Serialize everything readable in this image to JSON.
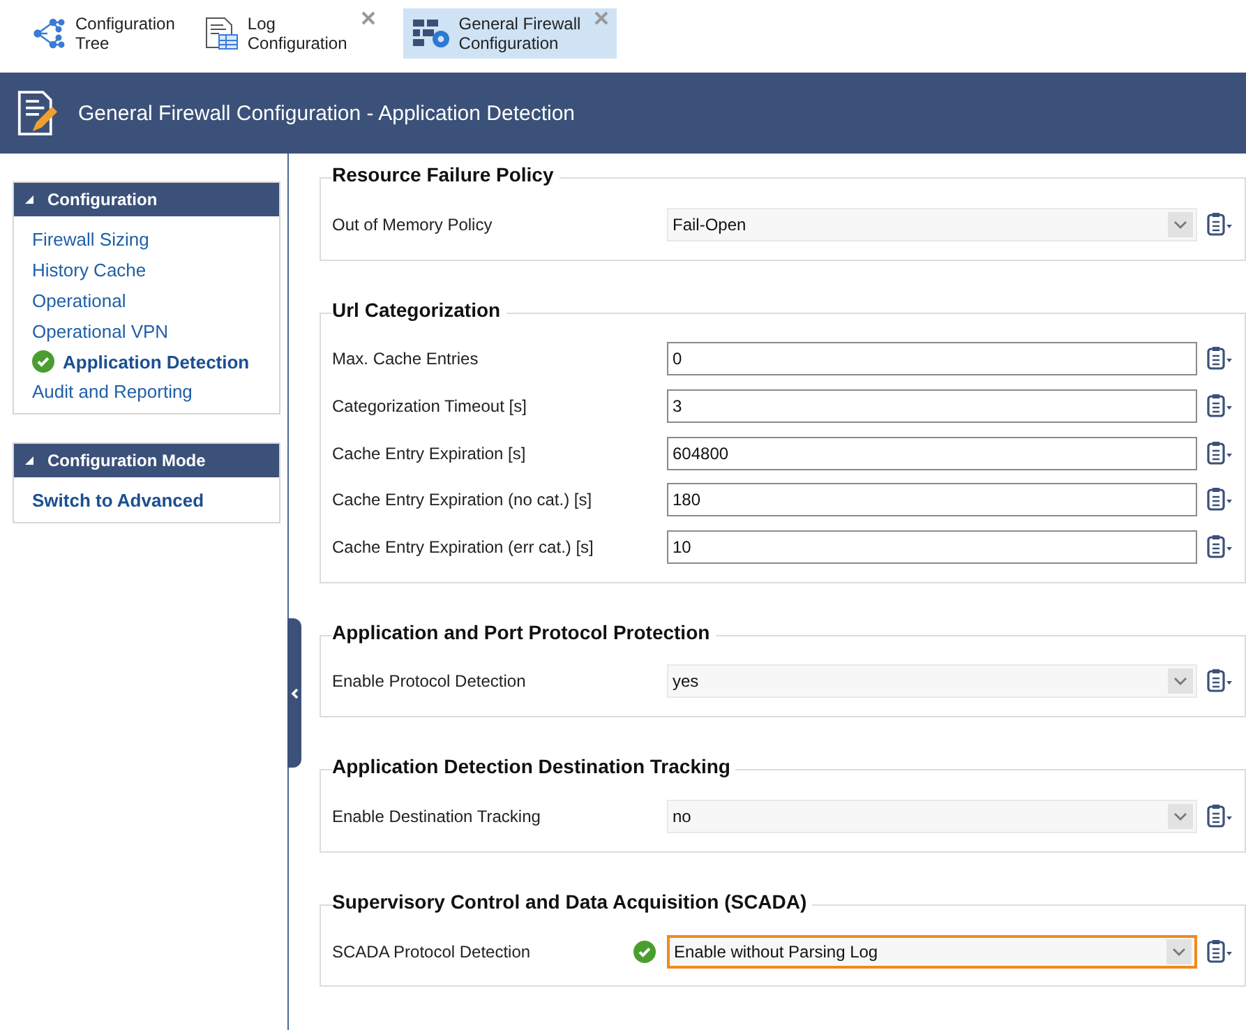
{
  "tabs": [
    {
      "label": "Configuration\nTree",
      "closable": false,
      "selected": false
    },
    {
      "label": "Log\nConfiguration",
      "closable": true,
      "selected": false
    },
    {
      "label": "General Firewall\nConfiguration",
      "closable": true,
      "selected": true
    }
  ],
  "header": {
    "title": "General Firewall Configuration - Application Detection"
  },
  "sidebar": [
    {
      "title": "Configuration",
      "expanded": true,
      "items": [
        {
          "label": "Firewall Sizing",
          "selected": false
        },
        {
          "label": "History Cache",
          "selected": false
        },
        {
          "label": "Operational",
          "selected": false
        },
        {
          "label": "Operational VPN",
          "selected": false
        },
        {
          "label": "Application Detection",
          "selected": true
        },
        {
          "label": "Audit and Reporting",
          "selected": false
        }
      ]
    },
    {
      "title": "Configuration Mode",
      "expanded": true,
      "items": [
        {
          "label": "Switch to Advanced",
          "selected": false,
          "kind": "action"
        }
      ]
    }
  ],
  "sections": [
    {
      "title": "Resource Failure Policy",
      "fields": [
        {
          "label": "Out of Memory Policy",
          "kind": "dropdown",
          "value": "Fail-Open",
          "modified": false
        }
      ]
    },
    {
      "title": "Url Categorization",
      "fields": [
        {
          "label": "Max. Cache Entries",
          "kind": "text",
          "value": "0",
          "modified": false
        },
        {
          "label": "Categorization Timeout [s]",
          "kind": "text",
          "value": "3",
          "modified": false
        },
        {
          "label": "Cache Entry Expiration [s]",
          "kind": "text",
          "value": "604800",
          "modified": false
        },
        {
          "label": "Cache Entry Expiration (no cat.) [s]",
          "kind": "text",
          "value": "180",
          "modified": false
        },
        {
          "label": "Cache Entry Expiration (err cat.) [s]",
          "kind": "text",
          "value": "10",
          "modified": false
        }
      ]
    },
    {
      "title": "Application and Port Protocol Protection",
      "fields": [
        {
          "label": "Enable Protocol Detection",
          "kind": "dropdown",
          "value": "yes",
          "modified": false
        }
      ]
    },
    {
      "title": "Application Detection Destination Tracking",
      "fields": [
        {
          "label": "Enable Destination Tracking",
          "kind": "dropdown",
          "value": "no",
          "modified": false
        }
      ]
    },
    {
      "title": "Supervisory Control and Data Acquisition (SCADA)",
      "fields": [
        {
          "label": "SCADA Protocol Detection",
          "kind": "dropdown",
          "value": "Enable without Parsing Log",
          "modified": true
        }
      ]
    }
  ]
}
